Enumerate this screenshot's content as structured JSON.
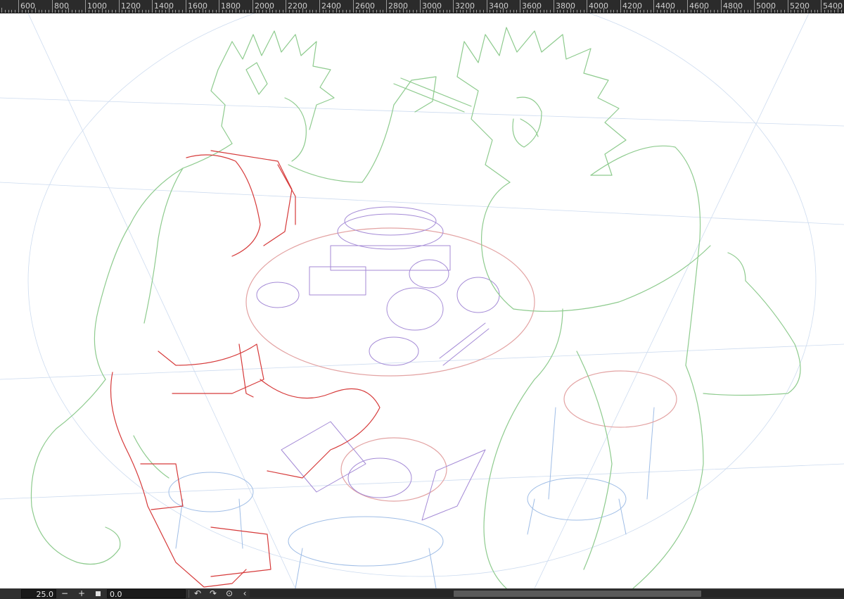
{
  "ruler": {
    "labels": [
      "600",
      "800",
      "1000",
      "1200",
      "1400",
      "1600",
      "1800",
      "2000",
      "2200",
      "2400",
      "2600",
      "2800",
      "3000",
      "3200",
      "3400",
      "3600",
      "3800",
      "4000",
      "4200",
      "4400",
      "4600",
      "4800",
      "5000",
      "5200",
      "5400"
    ]
  },
  "canvas": {
    "description_color_sketch_green": "#8fcf8f",
    "color_sketch_red": "#d83a3a",
    "color_sketch_purple": "#a98ad8",
    "color_sketch_blue": "#a8c4e8"
  },
  "statusbar": {
    "zoom_value": "25.0",
    "zoom_out_icon": "minus-icon",
    "zoom_in_icon": "plus-icon",
    "fit_icon": "square-icon",
    "rotation_value": "0.0",
    "rotate_left_icon": "rotate-ccw-icon",
    "rotate_right_icon": "rotate-cw-icon",
    "reset_rotation_icon": "reset-rotation-icon",
    "collapse_icon": "chevron-left-icon"
  }
}
